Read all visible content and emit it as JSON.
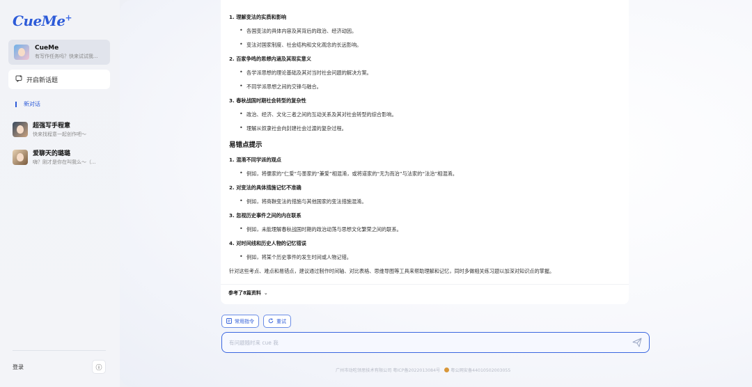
{
  "sidebar": {
    "logo": "CueMe",
    "logo_plus": "+",
    "assistant": {
      "name": "CueMe",
      "subtitle": "有写作任务吗？快来试试我..."
    },
    "new_topic": "开启新话题",
    "new_chat": "新对话",
    "conversations": [
      {
        "title": "超强写手程意",
        "subtitle": "快来找程意一起创作吧～"
      },
      {
        "title": "爱聊天的璐璐",
        "subtitle": "嗨？刚才是你在叫我么～（..."
      }
    ],
    "login": "登录",
    "info_icon": "ⓘ"
  },
  "answer": {
    "blocks": [
      {
        "type": "heading",
        "text": "1. 理解变法的实质和影响"
      },
      {
        "type": "bullet",
        "text": "各国变法的具体内容及其背后的政治、经济动因。"
      },
      {
        "type": "bullet",
        "text": "变法对国家制度、社会结构和文化观念的长远影响。"
      },
      {
        "type": "heading",
        "text": "2. 百家争鸣的思想内涵及其现实意义"
      },
      {
        "type": "bullet",
        "text": "各学派思想的理论基础及其对当时社会问题的解决方案。"
      },
      {
        "type": "bullet",
        "text": "不同学派思想之间的交锋与融合。"
      },
      {
        "type": "heading",
        "text": "3. 春秋战国时期社会转型的复杂性"
      },
      {
        "type": "bullet",
        "text": "政治、经济、文化三者之间的互动关系及其对社会转型的综合影响。"
      },
      {
        "type": "bullet",
        "text": "理解从奴隶社会向封建社会过渡的复杂过程。"
      },
      {
        "type": "section",
        "text": "易错点提示"
      },
      {
        "type": "heading",
        "text": "1. 混淆不同学派的观点"
      },
      {
        "type": "bullet",
        "text": "例如，将儒家的“仁爱”与墨家的“兼爱”相混淆，或将道家的“无为而治”与法家的“法治”相混淆。"
      },
      {
        "type": "heading",
        "text": "2. 对变法的具体措施记忆不准确"
      },
      {
        "type": "bullet",
        "text": "例如，将商鞅变法的措施与其他国家的变法措施混淆。"
      },
      {
        "type": "heading",
        "text": "3. 忽视历史事件之间的内在联系"
      },
      {
        "type": "bullet",
        "text": "例如，未能理解春秋战国时期的政治动荡与思想文化繁荣之间的联系。"
      },
      {
        "type": "heading",
        "text": "4. 对时间线和历史人物的记忆错误"
      },
      {
        "type": "bullet",
        "text": "例如，将某个历史事件的发生时间或人物记错。"
      }
    ],
    "summary": "针对这些考点、难点和易错点，建议通过制作时间轴、对比表格、思维导图等工具来帮助理解和记忆，同时多做相关练习题以加深对知识点的掌握。",
    "references": "参考了8篇资料",
    "references_chevron": "⌄"
  },
  "toolbar": {
    "commands_label": "常用指令",
    "retry_label": "重试"
  },
  "input": {
    "placeholder": "有问题随时来 cue 我"
  },
  "footer": {
    "company": "广州市动吃领思技术有限公司  粤ICP备2022013084号",
    "police": "粤公网安备44010502003055"
  }
}
